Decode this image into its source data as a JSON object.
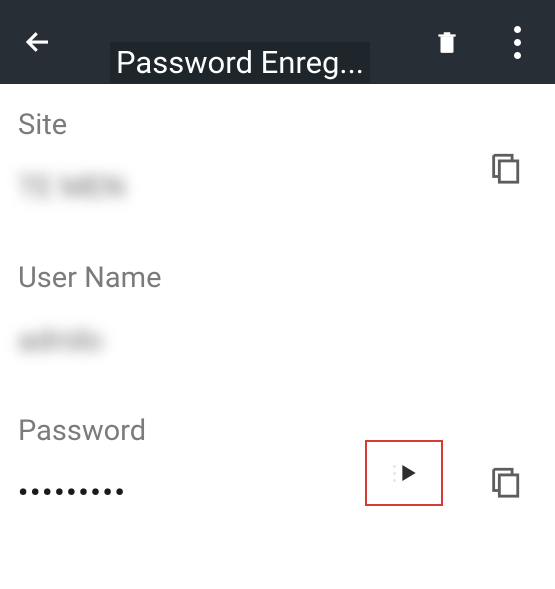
{
  "toolbar": {
    "title": "Password Enreg..."
  },
  "fields": {
    "site": {
      "label": "Site",
      "value": "TE MEN"
    },
    "username": {
      "label": "User Name",
      "value": "adrido"
    },
    "password": {
      "label": "Password",
      "value": "•••••••••"
    }
  },
  "colors": {
    "toolbar_bg": "#272e36",
    "highlight": "#d83a34",
    "label": "#7b7b7b"
  }
}
